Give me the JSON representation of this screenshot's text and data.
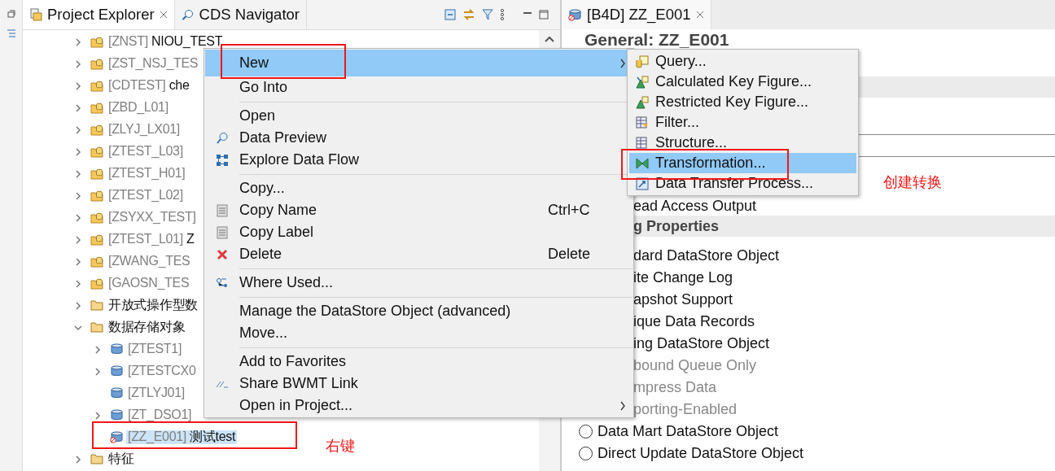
{
  "explorer": {
    "tabs": [
      {
        "label": "Project Explorer",
        "selected": true,
        "closable": true
      },
      {
        "label": "CDS Navigator",
        "selected": false,
        "closable": false
      }
    ],
    "tree": [
      {
        "kind": "area",
        "tech": "[ZNST]",
        "name": "NIOU_TEST",
        "expanded": false
      },
      {
        "kind": "area",
        "tech": "[ZST_NSJ_TES",
        "expanded": false
      },
      {
        "kind": "area",
        "tech": "[CDTEST]",
        "name": "che",
        "expanded": false
      },
      {
        "kind": "area",
        "tech": "[ZBD_L01]",
        "expanded": false
      },
      {
        "kind": "area",
        "tech": "[ZLYJ_LX01]",
        "expanded": false
      },
      {
        "kind": "area",
        "tech": "[ZTEST_L03]",
        "expanded": false
      },
      {
        "kind": "area",
        "tech": "[ZTEST_H01]",
        "expanded": false
      },
      {
        "kind": "area",
        "tech": "[ZTEST_L02]",
        "expanded": false
      },
      {
        "kind": "area",
        "tech": "[ZSYXX_TEST]",
        "expanded": false
      },
      {
        "kind": "area",
        "tech": "[ZTEST_L01]",
        "name": "Z",
        "expanded": false
      },
      {
        "kind": "area",
        "tech": "[ZWANG_TES",
        "expanded": false
      },
      {
        "kind": "area",
        "tech": "[GAOSN_TES",
        "expanded": false
      },
      {
        "kind": "folder",
        "name": "开放式操作型数",
        "expanded": false
      },
      {
        "kind": "folder",
        "name": "数据存储对象",
        "expanded": true,
        "children": [
          {
            "kind": "dso",
            "tech": "[ZTEST1]",
            "expanded": false
          },
          {
            "kind": "dso",
            "tech": "[ZTESTCX0",
            "expanded": false
          },
          {
            "kind": "dso",
            "tech": "[ZTLYJ01]"
          },
          {
            "kind": "dso",
            "tech": "[ZT_DSO1]",
            "expanded": false
          },
          {
            "kind": "dso-error",
            "tech": "[ZZ_E001]",
            "name": "测试test",
            "selected": true
          }
        ]
      },
      {
        "kind": "folder",
        "name": "特征",
        "expanded": false
      }
    ]
  },
  "context_menu": {
    "items": [
      {
        "kind": "plain",
        "label": "New",
        "selected": true,
        "submenu": true
      },
      {
        "kind": "plain",
        "label": "Go Into",
        "selected": false
      },
      {
        "kind": "separator"
      },
      {
        "kind": "plain",
        "label": "Open",
        "selected": false
      },
      {
        "kind": "preview",
        "label": "Data Preview",
        "selected": false
      },
      {
        "kind": "flow",
        "label": "Explore Data Flow",
        "selected": false
      },
      {
        "kind": "separator"
      },
      {
        "kind": "plain",
        "label": "Copy...",
        "selected": false
      },
      {
        "kind": "copy",
        "label": "Copy Name",
        "shortcut": "Ctrl+C",
        "selected": false
      },
      {
        "kind": "copy",
        "label": "Copy Label",
        "selected": false
      },
      {
        "kind": "delete",
        "label": "Delete",
        "shortcut": "Delete",
        "selected": false
      },
      {
        "kind": "separator"
      },
      {
        "kind": "where",
        "label": "Where Used...",
        "selected": false
      },
      {
        "kind": "separator"
      },
      {
        "kind": "plain",
        "label": "Manage the DataStore Object (advanced)",
        "selected": false
      },
      {
        "kind": "plain",
        "label": "Move...",
        "selected": false
      },
      {
        "kind": "separator"
      },
      {
        "kind": "plain",
        "label": "Add to Favorites",
        "selected": false
      },
      {
        "kind": "share",
        "label": "Share BWMT Link",
        "selected": false
      },
      {
        "kind": "plain",
        "label": "Open in Project...",
        "selected": false,
        "submenu": true
      }
    ]
  },
  "submenu": {
    "items": [
      {
        "kind": "query",
        "label": "Query...",
        "selected": false
      },
      {
        "kind": "calc",
        "label": "Calculated Key Figure...",
        "selected": false
      },
      {
        "kind": "restricted",
        "label": "Restricted Key Figure...",
        "selected": false
      },
      {
        "kind": "filter",
        "label": "Filter...",
        "selected": false
      },
      {
        "kind": "structure",
        "label": "Structure...",
        "selected": false
      },
      {
        "kind": "transformation",
        "label": "Transformation...",
        "selected": true
      },
      {
        "kind": "dtp",
        "label": "Data Transfer Process...",
        "selected": false
      }
    ]
  },
  "editor": {
    "tab": {
      "label": "[B4D] ZZ_E001"
    },
    "heading": "General: ZZ_E001",
    "rows": [
      {
        "kind": "text",
        "label": "ead Access Output"
      },
      {
        "kind": "section",
        "label": "g Properties"
      },
      {
        "kind": "option",
        "label": "dard DataStore Object",
        "disabled": false
      },
      {
        "kind": "option",
        "label": "ite Change Log",
        "disabled": false
      },
      {
        "kind": "option",
        "label": "apshot Support",
        "disabled": false
      },
      {
        "kind": "option",
        "label": "ique Data Records",
        "disabled": false
      },
      {
        "kind": "option",
        "label": "ing DataStore Object",
        "disabled": false
      },
      {
        "kind": "option",
        "label": "bound Queue Only",
        "disabled": true
      },
      {
        "kind": "option",
        "label": "mpress Data",
        "disabled": true
      },
      {
        "kind": "option",
        "label": "porting-Enabled",
        "disabled": true
      },
      {
        "kind": "radio",
        "label": "Data Mart DataStore Object",
        "selected": false
      },
      {
        "kind": "radio",
        "label": "Direct Update DataStore Object",
        "selected": false
      }
    ]
  },
  "annotations": {
    "labels": [
      {
        "text": "创建转换"
      },
      {
        "text": "右键"
      }
    ]
  }
}
